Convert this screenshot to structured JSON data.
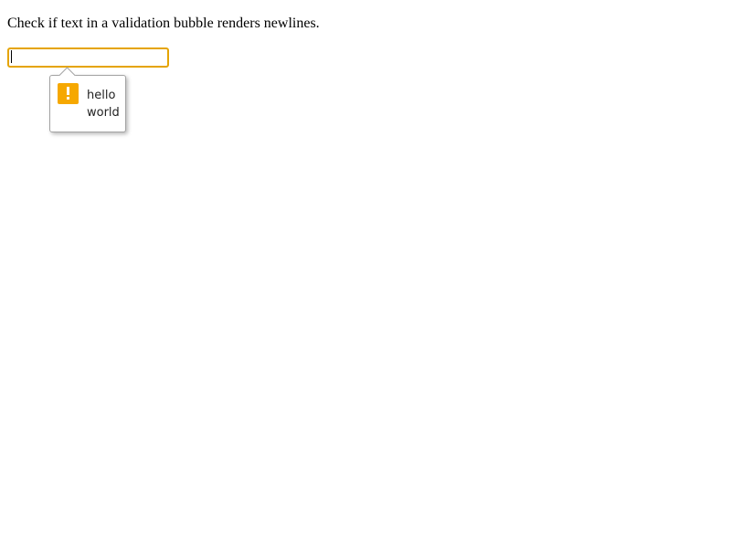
{
  "intro_text": "Check if text in a validation bubble renders newlines.",
  "input": {
    "value": ""
  },
  "validation_bubble": {
    "icon": "warning-icon",
    "lines": [
      "hello",
      "world"
    ],
    "accent_color": "#f6a800",
    "focus_border_color": "#e5a400"
  }
}
